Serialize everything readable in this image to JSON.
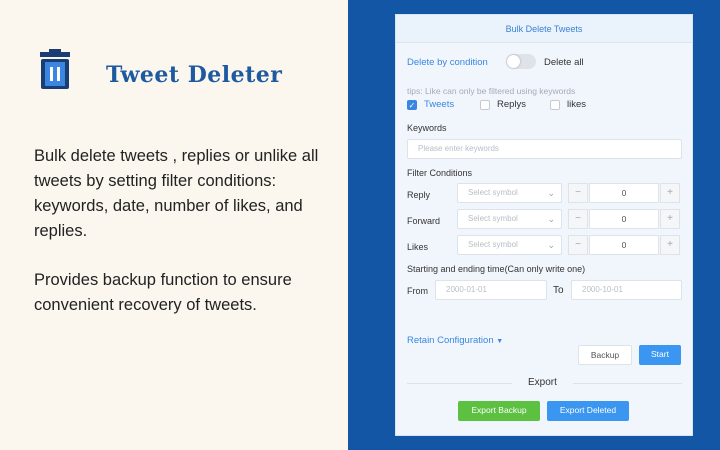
{
  "promo": {
    "app_title": "Tweet Deleter",
    "description": "Bulk delete tweets , replies or unlike all tweets  by setting filter conditions: keywords, date, number of likes, and replies.",
    "backup_note": "Provides backup function to ensure convenient recovery of tweets."
  },
  "panel": {
    "header": "Bulk Delete Tweets",
    "delete_by_condition": "Delete by condition",
    "delete_all": "Delete all",
    "tips": "tips: Like can only be filtered using keywords",
    "types": [
      {
        "label": "Tweets",
        "checked": true
      },
      {
        "label": "Replys",
        "checked": false
      },
      {
        "label": "likes",
        "checked": false
      }
    ],
    "keywords_label": "Keywords",
    "keywords_placeholder": "Please enter keywords",
    "filter_label": "Filter Conditions",
    "filters": [
      {
        "label": "Reply",
        "select_placeholder": "Select symbol",
        "minus": "−",
        "value": "0",
        "plus": "+"
      },
      {
        "label": "Forward",
        "select_placeholder": "Select symbol",
        "minus": "−",
        "value": "0",
        "plus": "+"
      },
      {
        "label": "Likes",
        "select_placeholder": "Select symbol",
        "minus": "−",
        "value": "0",
        "plus": "+"
      }
    ],
    "time_label": "Starting and ending time(Can only write one)",
    "from_label": "From",
    "from_value": "2000-01-01",
    "to_label": "To",
    "to_value": "2000-10-01",
    "retain_config": "Retain Configuration",
    "backup_button": "Backup",
    "start_button": "Start",
    "export_label": "Export",
    "export_backup_button": "Export Backup",
    "export_deleted_button": "Export Deleted"
  }
}
